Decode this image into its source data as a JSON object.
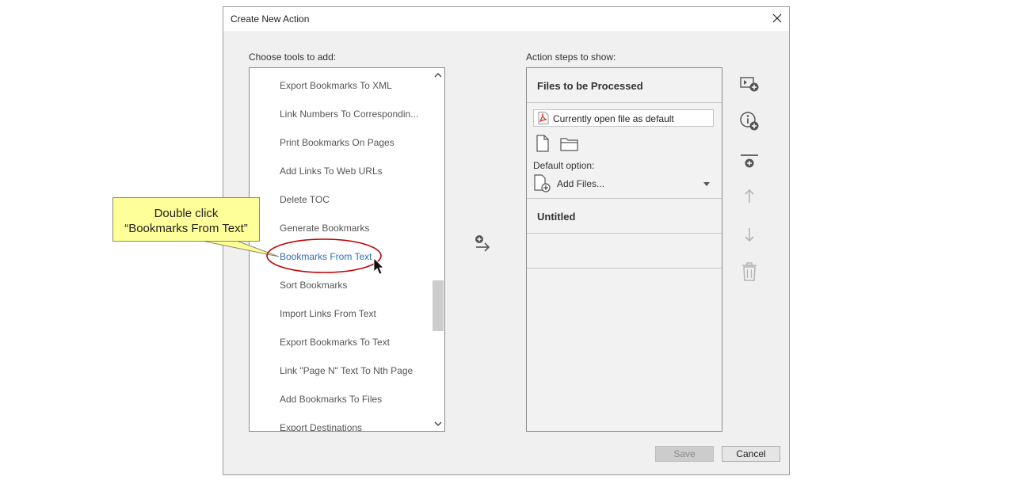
{
  "dialog": {
    "title": "Create New Action",
    "left_label": "Choose tools to add:",
    "right_label": "Action steps to show:"
  },
  "tools_list": {
    "items": [
      {
        "label": "Export Bookmarks To XML"
      },
      {
        "label": "Link Numbers To Correspondin..."
      },
      {
        "label": "Print Bookmarks On Pages"
      },
      {
        "label": "Add Links To Web URLs"
      },
      {
        "label": "Delete TOC"
      },
      {
        "label": "Generate Bookmarks"
      },
      {
        "label": "Bookmarks From Text"
      },
      {
        "label": "Sort Bookmarks"
      },
      {
        "label": "Import Links From Text"
      },
      {
        "label": "Export Bookmarks To Text"
      },
      {
        "label": "Link \"Page N\" Text To Nth Page"
      },
      {
        "label": "Add Bookmarks To Files"
      },
      {
        "label": "Export Destinations"
      }
    ],
    "selected": "Bookmarks From Text"
  },
  "steps": {
    "files_heading": "Files to be Processed",
    "file_field": "Currently open file as default",
    "default_option_label": "Default option:",
    "add_files_label": "Add Files...",
    "untitled_heading": "Untitled"
  },
  "buttons": {
    "save": "Save",
    "cancel": "Cancel"
  },
  "callout": {
    "line1": "Double click",
    "line2": "“Bookmarks From Text”"
  },
  "colors": {
    "selected_item": "#2f6eb5",
    "callout_bg": "#ffff99",
    "highlight_ring": "#c00000",
    "pdf_icon": "#d22f27"
  },
  "icons": {
    "close": "close-icon",
    "scroll_up": "chevron-up-icon",
    "scroll_down": "chevron-down-icon",
    "add_step": "add-to-action-icon",
    "blank_file": "file-icon",
    "folder": "folder-icon",
    "add_files": "add-file-icon",
    "side": [
      "add-panel-icon",
      "add-info-icon",
      "add-divider-icon",
      "move-up-icon",
      "move-down-icon",
      "delete-icon"
    ]
  }
}
